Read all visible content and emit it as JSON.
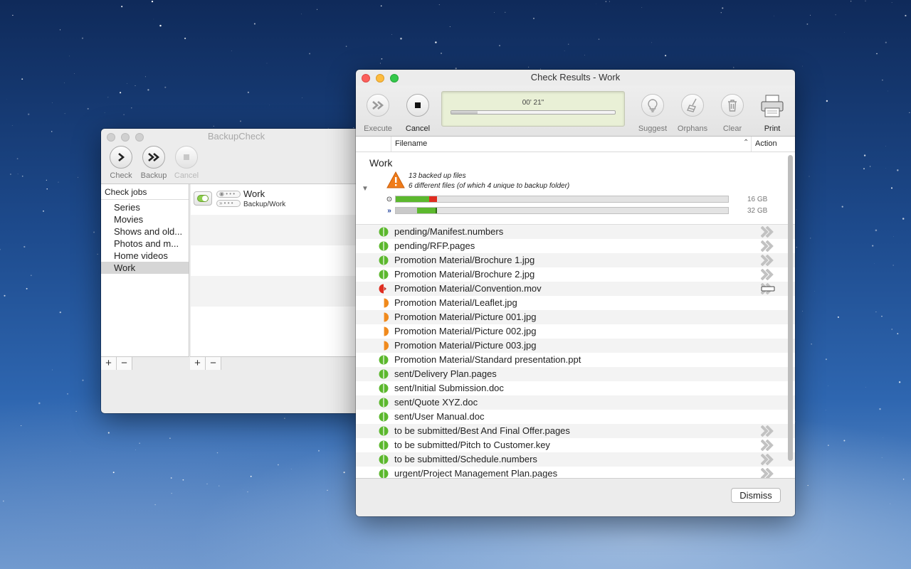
{
  "colors": {
    "green": "#5cb82e",
    "red": "#e02d20",
    "orange": "#f08a1d",
    "accent_gray": "#bdbdbd"
  },
  "backupcheck": {
    "title": "BackupCheck",
    "toolbar": {
      "check": "Check",
      "backup": "Backup",
      "cancel": "Cancel"
    },
    "jobs_header": "Check jobs",
    "jobs": [
      "Series",
      "Movies",
      "Shows and old...",
      "Photos and m...",
      "Home videos",
      "Work"
    ],
    "selected_job": "Work",
    "job_detail": {
      "name": "Work",
      "path": "Backup/Work"
    },
    "plus": "+",
    "minus": "−"
  },
  "results": {
    "title": "Check Results - Work",
    "toolbar": {
      "execute": "Execute",
      "cancel": "Cancel",
      "suggest": "Suggest",
      "orphans": "Orphans",
      "clear": "Clear",
      "print": "Print"
    },
    "elapsed": "00' 21\"",
    "progress_fraction": 0.16,
    "columns": {
      "filename": "Filename",
      "action": "Action"
    },
    "summary": {
      "title": "Work",
      "line1": "13 backed up files",
      "line2": "6 different files (of which 4 unique to backup folder)",
      "source_size": "16 GB",
      "backup_size": "32 GB",
      "source_bar": {
        "green": 0.1,
        "red": 0.025
      },
      "backup_bar": {
        "gray": 0.065,
        "green": 0.055,
        "darkgreen": 0.005
      }
    },
    "files": [
      {
        "name": "pending/Manifest.numbers",
        "status": "green-full",
        "action": "forward"
      },
      {
        "name": "pending/RFP.pages",
        "status": "green-full",
        "action": "forward"
      },
      {
        "name": "Promotion Material/Brochure 1.jpg",
        "status": "green-full",
        "action": "forward"
      },
      {
        "name": "Promotion Material/Brochure 2.jpg",
        "status": "green-full",
        "action": "forward"
      },
      {
        "name": "Promotion Material/Convention.mov",
        "status": "red-left",
        "action": "forward-erase"
      },
      {
        "name": "Promotion Material/Leaflet.jpg",
        "status": "orange-right",
        "action": ""
      },
      {
        "name": "Promotion Material/Picture 001.jpg",
        "status": "orange-right",
        "action": ""
      },
      {
        "name": "Promotion Material/Picture 002.jpg",
        "status": "orange-right",
        "action": ""
      },
      {
        "name": "Promotion Material/Picture 003.jpg",
        "status": "orange-right",
        "action": ""
      },
      {
        "name": "Promotion Material/Standard presentation.ppt",
        "status": "green-full",
        "action": ""
      },
      {
        "name": "sent/Delivery Plan.pages",
        "status": "green-full",
        "action": ""
      },
      {
        "name": "sent/Initial Submission.doc",
        "status": "green-full",
        "action": ""
      },
      {
        "name": "sent/Quote XYZ.doc",
        "status": "green-full",
        "action": ""
      },
      {
        "name": "sent/User Manual.doc",
        "status": "green-full",
        "action": ""
      },
      {
        "name": "to be submitted/Best And Final Offer.pages",
        "status": "green-full",
        "action": "forward"
      },
      {
        "name": "to be submitted/Pitch to Customer.key",
        "status": "green-full",
        "action": "forward"
      },
      {
        "name": "to be submitted/Schedule.numbers",
        "status": "green-full",
        "action": "forward"
      },
      {
        "name": "urgent/Project Management Plan.pages",
        "status": "green-full",
        "action": "forward"
      }
    ],
    "dismiss": "Dismiss"
  }
}
